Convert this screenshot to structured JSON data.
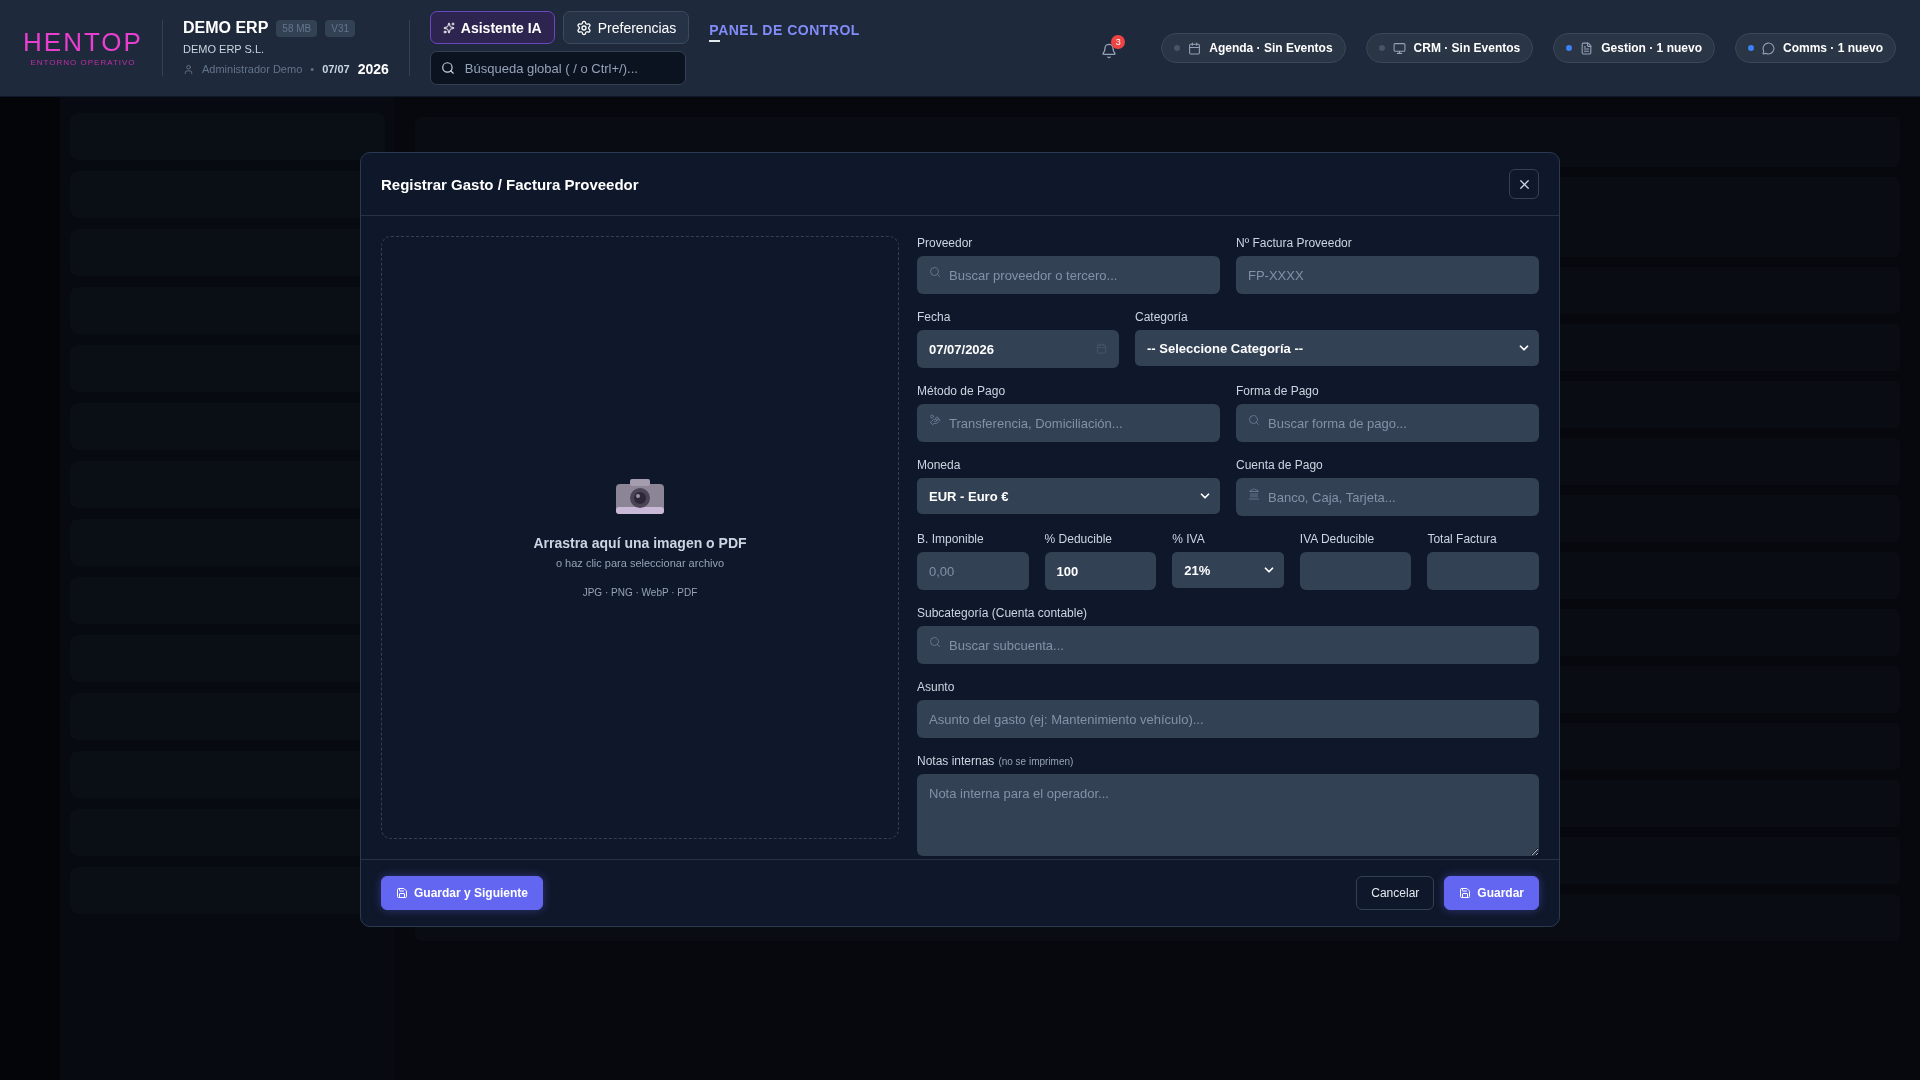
{
  "header": {
    "logo": "HENTOP",
    "logo_subtitle": "ENTORNO OPERATIVO",
    "app_name": "DEMO ERP",
    "badges": [
      "58 MB",
      "V31"
    ],
    "company": "DEMO ERP S.L.",
    "user": "Administrador Demo",
    "separator": "•",
    "date": "07/07",
    "year": "2026",
    "assistant_button": "Asistente IA",
    "preferences_button": "Preferencias",
    "search_placeholder": "Búsqueda global ( / o Ctrl+/)...",
    "section_title": "PANEL DE CONTROL",
    "notification_count": "3",
    "pills": [
      {
        "kind": "calendar",
        "label": "Agenda · Sin Eventos",
        "active": false
      },
      {
        "kind": "monitor",
        "label": "CRM · Sin Eventos",
        "active": false
      },
      {
        "kind": "document",
        "label": "Gestion · 1 nuevo",
        "active": true
      },
      {
        "kind": "chat",
        "label": "Comms · 1 nuevo",
        "active": true
      }
    ]
  },
  "modal": {
    "title": "Registrar Gasto / Factura Proveedor",
    "dropzone": {
      "title": "Arrastra aquí una imagen o PDF",
      "hint": "o haz clic para seleccionar archivo",
      "formats": "JPG · PNG · WebP · PDF"
    },
    "fields": [
      {
        "kind": "search",
        "label": "Proveedor",
        "placeholder": "Buscar proveedor o tercero..."
      },
      {
        "kind": "text",
        "label": "Nº Factura Proveedor",
        "placeholder": "FP-XXXX"
      },
      {
        "kind": "date",
        "label": "Fecha",
        "value": "07/07/2026"
      },
      {
        "kind": "select",
        "label": "Categoría",
        "value": "-- Seleccione Categoría --"
      },
      {
        "kind": "method",
        "label": "Método de Pago",
        "placeholder": "Transferencia, Domiciliación..."
      },
      {
        "kind": "search",
        "label": "Forma de Pago",
        "placeholder": "Buscar forma de pago..."
      },
      {
        "kind": "select",
        "label": "Moneda",
        "value": "EUR - Euro €"
      },
      {
        "kind": "account",
        "label": "Cuenta de Pago",
        "placeholder": "Banco, Caja, Tarjeta..."
      },
      {
        "kind": "text",
        "label": "B. Imponible",
        "placeholder": "0,00"
      },
      {
        "kind": "text",
        "label": "% Deducible",
        "value": "100"
      },
      {
        "kind": "select",
        "label": "% IVA",
        "value": "21%"
      },
      {
        "kind": "text",
        "label": "IVA Deducible"
      },
      {
        "kind": "text",
        "label": "Total Factura"
      },
      {
        "kind": "search",
        "label": "Subcategoría (Cuenta contable)",
        "placeholder": "Buscar subcuenta..."
      },
      {
        "kind": "text",
        "label": "Asunto",
        "placeholder": "Asunto del gasto (ej: Mantenimiento vehículo)..."
      },
      {
        "kind": "textarea",
        "label": "Notas internas",
        "note": "(no se imprimen)",
        "placeholder": "Nota interna para el operador..."
      }
    ],
    "buttons": [
      {
        "kind": "primary",
        "label": "Guardar y Siguiente"
      },
      {
        "kind": "secondary",
        "label": "Cancelar"
      },
      {
        "kind": "primary",
        "label": "Guardar"
      }
    ]
  }
}
